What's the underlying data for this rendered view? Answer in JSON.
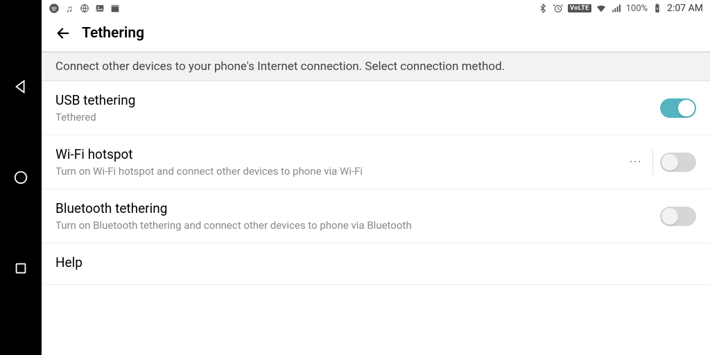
{
  "status_bar": {
    "left_icons": [
      "spotify-icon",
      "music-note-icon",
      "globe-icon",
      "image-icon",
      "calendar-icon"
    ],
    "right": {
      "bluetooth": true,
      "alarm": true,
      "volte_label": "VoLTE",
      "wifi": true,
      "signal": true,
      "battery_text": "100%",
      "time": "2:07 AM"
    }
  },
  "header": {
    "title": "Tethering",
    "subtitle": "Connect other devices to your phone's Internet connection. Select connection method."
  },
  "settings": [
    {
      "key": "usb",
      "title": "USB tethering",
      "desc": "Tethered",
      "toggle": true,
      "enabled": true,
      "overflow": false
    },
    {
      "key": "wifi",
      "title": "Wi-Fi hotspot",
      "desc": "Turn on Wi-Fi hotspot and connect other devices to phone via Wi-Fi",
      "toggle": true,
      "enabled": false,
      "overflow": true
    },
    {
      "key": "bt",
      "title": "Bluetooth tethering",
      "desc": "Turn on Bluetooth tethering and connect other devices to phone via Bluetooth",
      "toggle": true,
      "enabled": false,
      "overflow": false
    },
    {
      "key": "help",
      "title": "Help",
      "desc": "",
      "toggle": false,
      "overflow": false
    }
  ]
}
